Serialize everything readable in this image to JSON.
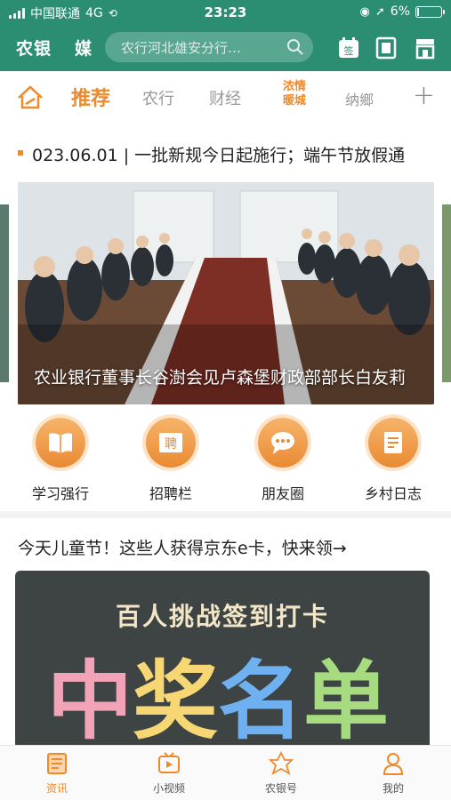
{
  "status_bar": {
    "carrier": "中国联通",
    "network": "4G",
    "time": "23:23",
    "battery": "6%",
    "battery_level": 0.06
  },
  "header": {
    "brand": "农银",
    "media": "媒",
    "search_placeholder": "农行河北雄安分行…"
  },
  "tabs": {
    "recommend": "推荐",
    "abc": "农行",
    "finance": "财经",
    "special_line1": "浓情",
    "special_line2": "暖城",
    "tab5": "纳鄉"
  },
  "ticker": {
    "text": "023.06.01 | 一批新规今日起施行；端午节放假通"
  },
  "banner": {
    "caption": "农业银行董事长谷澍会见卢森堡财政部部长白友莉"
  },
  "quick": [
    {
      "label": "学习强行",
      "icon": "book-icon"
    },
    {
      "label": "招聘栏",
      "icon": "recruit-icon"
    },
    {
      "label": "朋友圈",
      "icon": "chat-icon"
    },
    {
      "label": "乡村日志",
      "icon": "diary-icon"
    }
  ],
  "promo": {
    "title": "今天儿童节！这些人获得京东e卡，快来领→",
    "subtitle": "百人挑战签到打卡",
    "big_chars": [
      {
        "char": "中",
        "color": "#f3a3b8"
      },
      {
        "char": "奖",
        "color": "#f6d774"
      },
      {
        "char": "名",
        "color": "#6fb1f0"
      },
      {
        "char": "单",
        "color": "#a6dc7f"
      }
    ]
  },
  "bottom_nav": [
    {
      "label": "资讯",
      "icon": "news-icon",
      "active": true
    },
    {
      "label": "小视频",
      "icon": "video-icon",
      "active": false
    },
    {
      "label": "农银号",
      "icon": "star-icon",
      "active": false
    },
    {
      "label": "我的",
      "icon": "profile-icon",
      "active": false
    }
  ],
  "colors": {
    "brand_green": "#2b8e73",
    "accent_orange": "#ef8a2b"
  }
}
